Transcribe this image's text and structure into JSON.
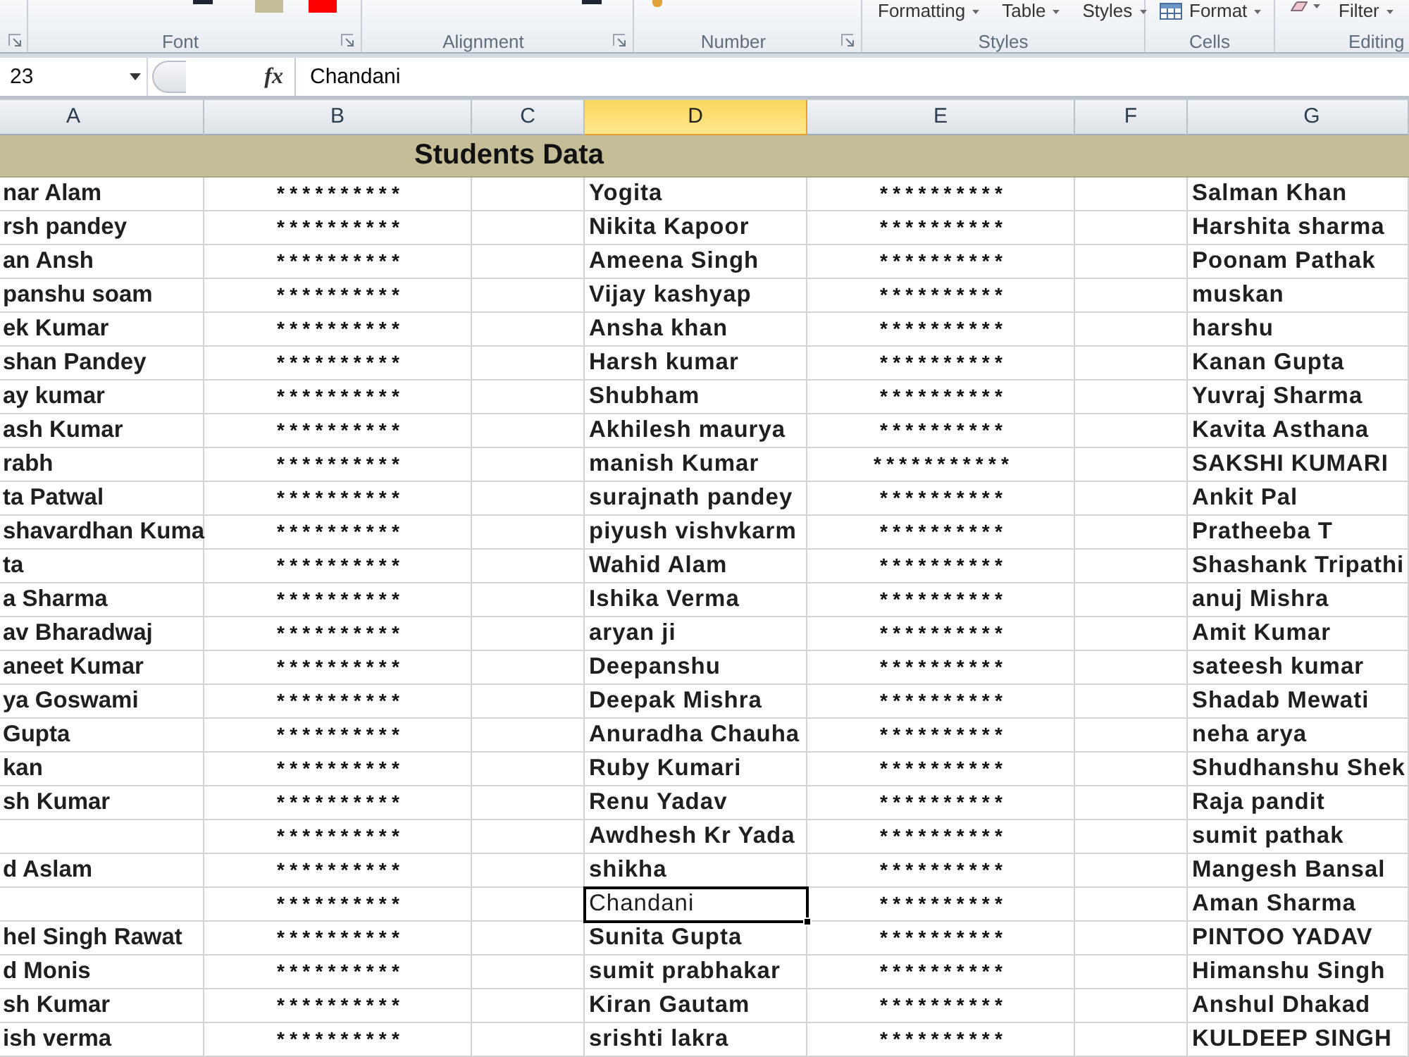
{
  "ribbon": {
    "groups": [
      {
        "launcher": true
      },
      {
        "label": "Font",
        "launcher": true,
        "items": [
          {
            "kind": "line"
          },
          {
            "kind": "swatch",
            "color": "#c4bd97"
          },
          {
            "kind": "swatch",
            "color": "#ff0000"
          }
        ]
      },
      {
        "label": "Alignment",
        "launcher": true,
        "items": [
          {
            "kind": "line"
          }
        ]
      },
      {
        "label": "Number",
        "launcher": true,
        "items": [
          {
            "kind": "block"
          }
        ]
      },
      {
        "label": "Styles",
        "launcher": false,
        "items": [
          {
            "kind": "dropdown",
            "label": "Formatting"
          },
          {
            "kind": "dropdown",
            "label": "Table"
          },
          {
            "kind": "dropdown",
            "label": "Styles"
          }
        ]
      },
      {
        "label": "Cells",
        "launcher": false,
        "items": [
          {
            "kind": "table_dropdown",
            "label": "Format"
          }
        ]
      },
      {
        "label": "Editing",
        "launcher": false,
        "items": [
          {
            "kind": "eraser_dropdown"
          },
          {
            "kind": "dropdown",
            "label": "Filter"
          }
        ]
      }
    ]
  },
  "formula_bar": {
    "name_box": "23",
    "function_button": "fx",
    "formula": "Chandani"
  },
  "sheet": {
    "columns": [
      {
        "label": "A",
        "selected": false
      },
      {
        "label": "B",
        "selected": false
      },
      {
        "label": "C",
        "selected": false
      },
      {
        "label": "D",
        "selected": true
      },
      {
        "label": "E",
        "selected": false
      },
      {
        "label": "F",
        "selected": false
      },
      {
        "label": "G",
        "selected": false
      }
    ],
    "title": "Students Data",
    "rows": [
      {
        "a": "nar Alam",
        "b": "**********",
        "d": "Yogita",
        "d_bold": true,
        "e": "**********",
        "g": "Salman Khan",
        "selected": false
      },
      {
        "a": "rsh pandey",
        "b": "**********",
        "d": "Nikita Kapoor",
        "d_bold": true,
        "e": "**********",
        "g": "Harshita sharma",
        "selected": false
      },
      {
        "a": "an Ansh",
        "b": "**********",
        "d": "Ameena Singh",
        "d_bold": true,
        "e": "**********",
        "g": "Poonam Pathak",
        "selected": false
      },
      {
        "a": "panshu soam",
        "b": "**********",
        "d": "Vijay kashyap",
        "d_bold": true,
        "e": "**********",
        "g": "muskan",
        "selected": false
      },
      {
        "a": "ek Kumar",
        "b": "**********",
        "d": "Ansha khan",
        "d_bold": true,
        "e": "**********",
        "g": "harshu",
        "selected": false
      },
      {
        "a": "shan Pandey",
        "b": "**********",
        "d": "Harsh kumar",
        "d_bold": true,
        "e": "**********",
        "g": "Kanan Gupta",
        "selected": false
      },
      {
        "a": "ay kumar",
        "b": "**********",
        "d": "Shubham",
        "d_bold": true,
        "e": "**********",
        "g": "Yuvraj Sharma",
        "selected": false
      },
      {
        "a": "ash Kumar",
        "b": "**********",
        "d": "Akhilesh maurya",
        "d_bold": true,
        "e": "**********",
        "g": "Kavita Asthana",
        "selected": false
      },
      {
        "a": "rabh",
        "b": "**********",
        "d": "manish Kumar",
        "d_bold": true,
        "e": "***********",
        "g": "SAKSHI KUMARI",
        "selected": false
      },
      {
        "a": "ta Patwal",
        "b": "**********",
        "d": "surajnath pandey",
        "d_bold": true,
        "e": "**********",
        "g": "Ankit Pal",
        "selected": false
      },
      {
        "a": "shavardhan Kuma",
        "b": "**********",
        "d": "piyush vishvkarm",
        "d_bold": true,
        "e": "**********",
        "g": "Pratheeba T",
        "selected": false
      },
      {
        "a": "ta",
        "b": "**********",
        "d": "Wahid Alam",
        "d_bold": true,
        "e": "**********",
        "g": "Shashank Tripathi",
        "selected": false
      },
      {
        "a": "a Sharma",
        "b": "**********",
        "d": "Ishika Verma",
        "d_bold": true,
        "e": "**********",
        "g": "anuj Mishra",
        "selected": false
      },
      {
        "a": "av Bharadwaj",
        "b": "**********",
        "d": "aryan ji",
        "d_bold": true,
        "e": "**********",
        "g": "Amit Kumar",
        "selected": false
      },
      {
        "a": "aneet Kumar",
        "b": "**********",
        "d": "Deepanshu",
        "d_bold": true,
        "e": "**********",
        "g": "sateesh kumar",
        "selected": false
      },
      {
        "a": "ya Goswami",
        "b": "**********",
        "d": "Deepak Mishra",
        "d_bold": true,
        "e": "**********",
        "g": "Shadab Mewati",
        "selected": false
      },
      {
        "a": "Gupta",
        "b": "**********",
        "d": "Anuradha Chauha",
        "d_bold": true,
        "e": "**********",
        "g": "neha arya",
        "selected": false
      },
      {
        "a": "kan",
        "b": "**********",
        "d": "Ruby Kumari",
        "d_bold": true,
        "e": "**********",
        "g": "Shudhanshu Shek",
        "selected": false
      },
      {
        "a": "sh Kumar",
        "b": "**********",
        "d": "Renu Yadav",
        "d_bold": true,
        "e": "**********",
        "g": "Raja pandit",
        "selected": false
      },
      {
        "b": "**********",
        "d": "Awdhesh Kr Yada",
        "d_bold": true,
        "e": "**********",
        "g": "sumit pathak",
        "selected": false
      },
      {
        "a": "d Aslam",
        "b": "**********",
        "d": "shikha",
        "d_bold": true,
        "e": "**********",
        "g": "Mangesh Bansal",
        "selected": false
      },
      {
        "b": "**********",
        "d": "Chandani",
        "d_bold": false,
        "e": "**********",
        "g": "Aman Sharma",
        "selected": true
      },
      {
        "a": "hel Singh Rawat",
        "b": "**********",
        "d": "Sunita Gupta",
        "d_bold": true,
        "e": "**********",
        "g": "PINTOO YADAV",
        "selected": false
      },
      {
        "a": "d Monis",
        "b": "**********",
        "d": "sumit prabhakar",
        "d_bold": true,
        "e": "**********",
        "g": "Himanshu Singh",
        "selected": false
      },
      {
        "a": "sh Kumar",
        "b": "**********",
        "d": "Kiran Gautam",
        "d_bold": true,
        "e": "**********",
        "g": "Anshul Dhakad",
        "selected": false
      },
      {
        "a": "ish verma",
        "b": "**********",
        "d": "srishti lakra",
        "d_bold": true,
        "e": "**********",
        "g": "KULDEEP SINGH",
        "selected": false
      }
    ]
  }
}
